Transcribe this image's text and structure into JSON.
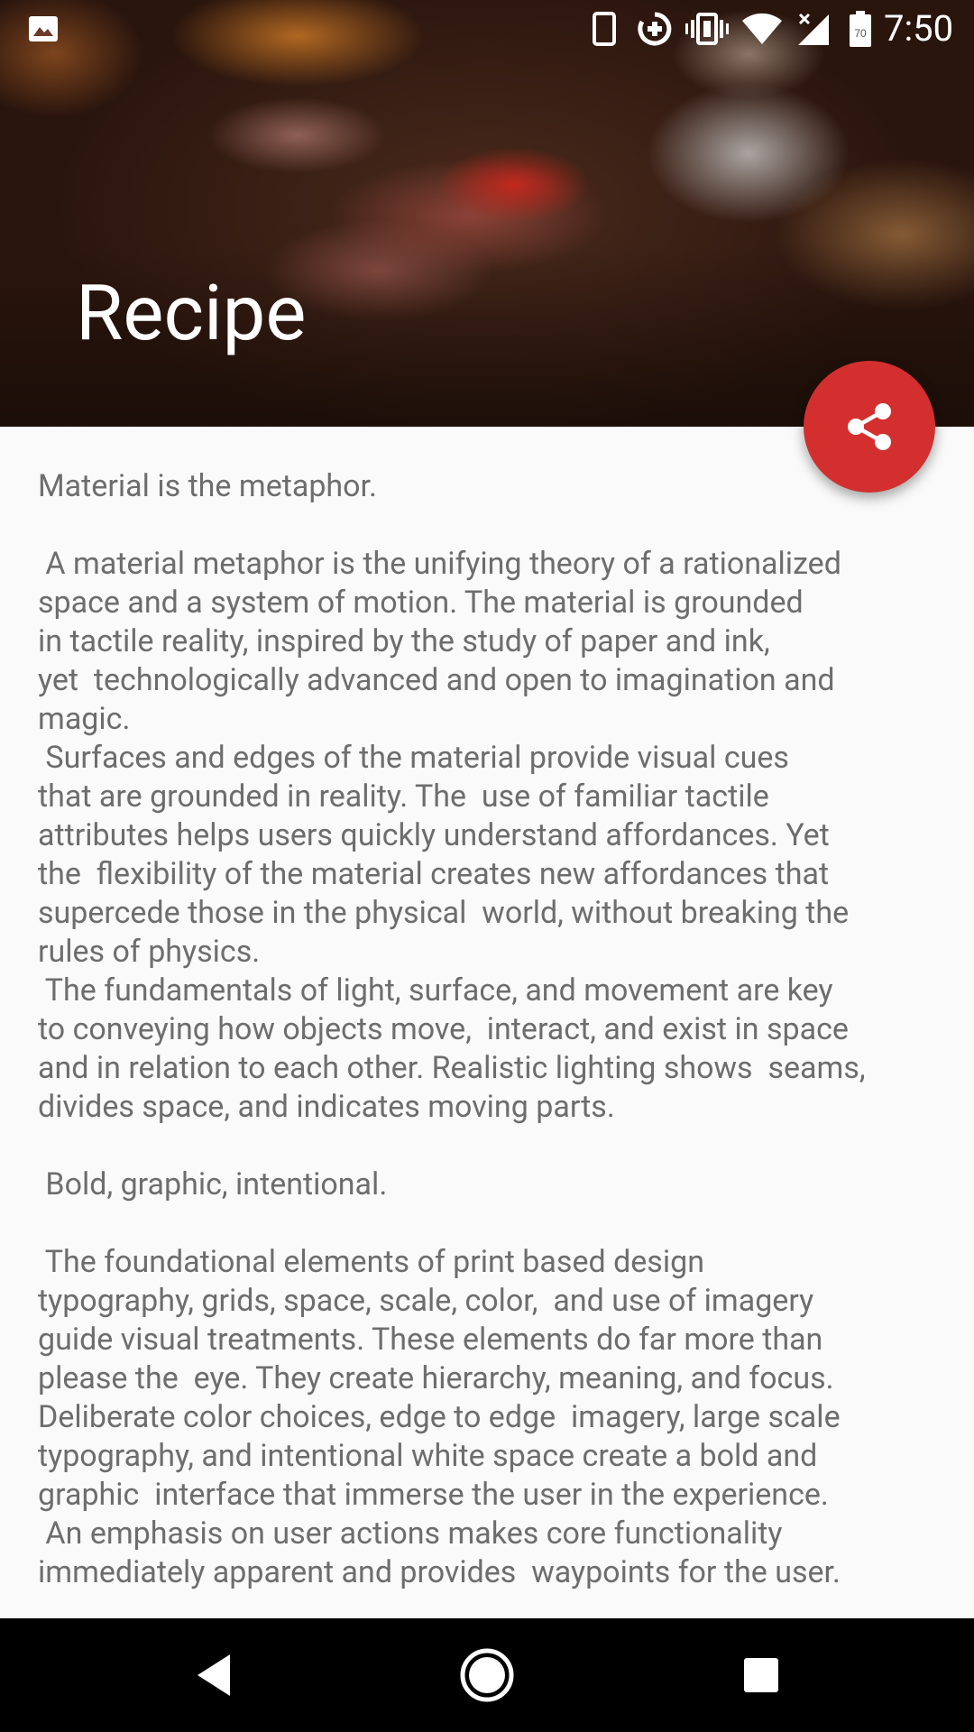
{
  "status_bar": {
    "time": "7:50",
    "battery_level": "70",
    "icons": [
      "image-icon",
      "phone-icon",
      "data-saver-icon",
      "vibrate-icon",
      "wifi-icon",
      "signal-icon",
      "battery-icon"
    ]
  },
  "header": {
    "title": "Recipe"
  },
  "fab": {
    "icon": "share-icon",
    "color": "#d32f2f"
  },
  "content": {
    "paragraphs": [
      {
        "lines": [
          "Material is the metaphor."
        ]
      },
      {
        "lines": [
          " A material metaphor is the unifying theory of a rationalized",
          "space and a system of motion. The material is grounded",
          "in tactile reality, inspired by the study of paper and ink,",
          "yet  technologically advanced and open to imagination and",
          "magic.",
          " Surfaces and edges of the material provide visual cues",
          "that are grounded in reality. The  use of familiar tactile",
          "attributes helps users quickly understand affordances. Yet",
          "the  flexibility of the material creates new affordances that",
          "supercede those in the physical  world, without breaking the",
          "rules of physics.",
          " The fundamentals of light, surface, and movement are key",
          "to conveying how objects move,  interact, and exist in space",
          "and in relation to each other. Realistic lighting shows  seams,",
          "divides space, and indicates moving parts."
        ]
      },
      {
        "lines": [
          " Bold, graphic, intentional."
        ]
      },
      {
        "lines": [
          " The foundational elements of print based design",
          "typography, grids, space, scale, color,  and use of imagery",
          "guide visual treatments. These elements do far more than",
          "please the  eye. They create hierarchy, meaning, and focus.",
          "Deliberate color choices, edge to edge  imagery, large scale",
          "typography, and intentional white space create a bold and",
          "graphic  interface that immerse the user in the experience.",
          " An emphasis on user actions makes core functionality",
          "immediately apparent and provides  waypoints for the user."
        ]
      }
    ]
  },
  "nav_bar": {
    "buttons": [
      "back-icon",
      "home-icon",
      "recents-icon"
    ]
  }
}
